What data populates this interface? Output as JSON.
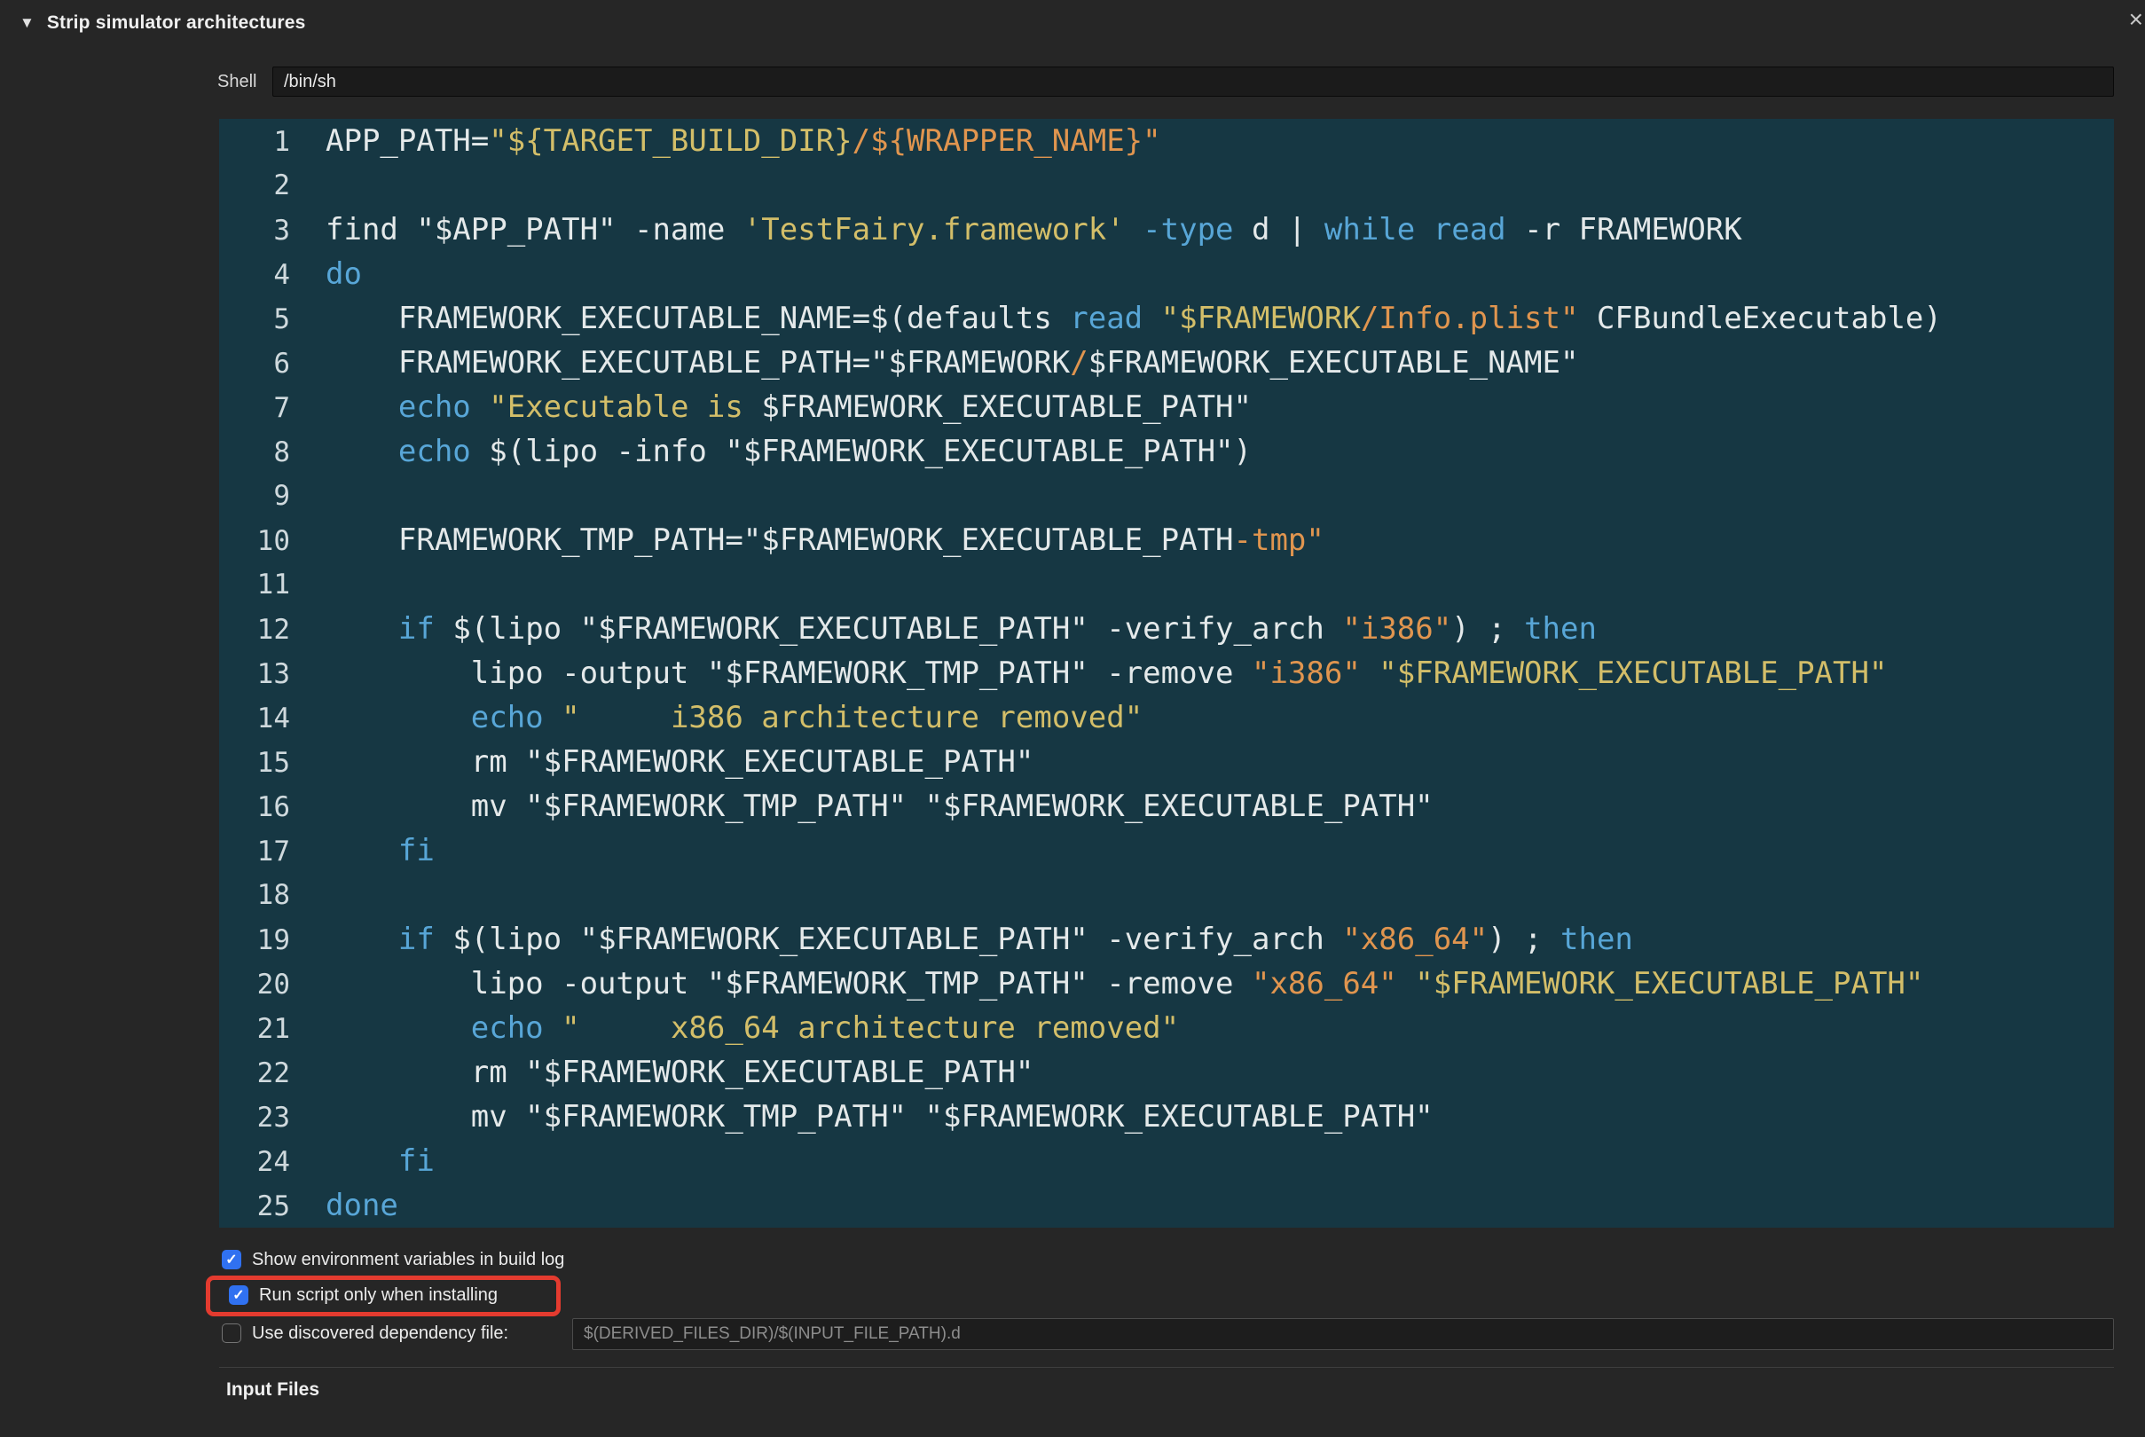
{
  "header": {
    "title": "Strip simulator architectures"
  },
  "icons": {
    "disclosure": "▼",
    "close": "×",
    "check": "✓"
  },
  "shell_row": {
    "label": "Shell",
    "value": "/bin/sh"
  },
  "colors": {
    "page_background": "#262626",
    "editor_background": "#163743",
    "code_plain": "#e4e9ea",
    "code_keyword": "#58a6d7",
    "code_string_yellow": "#d3be69",
    "code_string_orange": "#e0954f",
    "checkbox_accent": "#3071f0",
    "annotation_red": "#e43b2f"
  },
  "editor": {
    "lines": [
      {
        "num": "1",
        "tokens": [
          [
            "p",
            "APP_PATH="
          ],
          [
            "s",
            "\"${TARGET_BUILD_DIR}"
          ],
          [
            "o",
            "/${WRAPPER_NAME}\""
          ]
        ]
      },
      {
        "num": "2",
        "tokens": []
      },
      {
        "num": "3",
        "tokens": [
          [
            "p",
            "find \"$APP_PATH\" -name "
          ],
          [
            "s",
            "'TestFairy.framework'"
          ],
          [
            "p",
            " "
          ],
          [
            "k",
            "-type"
          ],
          [
            "p",
            " d | "
          ],
          [
            "k",
            "while"
          ],
          [
            "p",
            " "
          ],
          [
            "k",
            "read"
          ],
          [
            "p",
            " -r FRAMEWORK"
          ]
        ]
      },
      {
        "num": "4",
        "tokens": [
          [
            "k",
            "do"
          ]
        ]
      },
      {
        "num": "5",
        "tokens": [
          [
            "p",
            "    FRAMEWORK_EXECUTABLE_NAME=$(defaults "
          ],
          [
            "k",
            "read"
          ],
          [
            "p",
            " "
          ],
          [
            "s",
            "\"$FRAMEWORK"
          ],
          [
            "o",
            "/Info.plist\""
          ],
          [
            "p",
            " CFBundleExecutable)"
          ]
        ]
      },
      {
        "num": "6",
        "tokens": [
          [
            "p",
            "    FRAMEWORK_EXECUTABLE_PATH=\"$FRAMEWORK"
          ],
          [
            "o",
            "/"
          ],
          [
            "p",
            "$FRAMEWORK_EXECUTABLE_NAME\""
          ]
        ]
      },
      {
        "num": "7",
        "tokens": [
          [
            "p",
            "    "
          ],
          [
            "k",
            "echo"
          ],
          [
            "p",
            " "
          ],
          [
            "s",
            "\"Executable is "
          ],
          [
            "p",
            "$FRAMEWORK_EXECUTABLE_PATH\""
          ]
        ]
      },
      {
        "num": "8",
        "tokens": [
          [
            "p",
            "    "
          ],
          [
            "k",
            "echo"
          ],
          [
            "p",
            " $(lipo -info \"$FRAMEWORK_EXECUTABLE_PATH\")"
          ]
        ]
      },
      {
        "num": "9",
        "tokens": []
      },
      {
        "num": "10",
        "tokens": [
          [
            "p",
            "    FRAMEWORK_TMP_PATH=\"$FRAMEWORK_EXECUTABLE_PATH"
          ],
          [
            "o",
            "-tmp\""
          ]
        ]
      },
      {
        "num": "11",
        "tokens": []
      },
      {
        "num": "12",
        "tokens": [
          [
            "p",
            "    "
          ],
          [
            "k",
            "if"
          ],
          [
            "p",
            " $(lipo \"$FRAMEWORK_EXECUTABLE_PATH\" -verify_arch "
          ],
          [
            "o",
            "\"i386\""
          ],
          [
            "p",
            ") ; "
          ],
          [
            "k",
            "then"
          ]
        ]
      },
      {
        "num": "13",
        "tokens": [
          [
            "p",
            "        lipo -output \"$FRAMEWORK_TMP_PATH\" -remove "
          ],
          [
            "o",
            "\"i386\""
          ],
          [
            "p",
            " "
          ],
          [
            "s",
            "\"$FRAMEWORK_EXECUTABLE_PATH\""
          ]
        ]
      },
      {
        "num": "14",
        "tokens": [
          [
            "p",
            "        "
          ],
          [
            "k",
            "echo"
          ],
          [
            "p",
            " "
          ],
          [
            "s",
            "\"     i386 architecture removed\""
          ]
        ]
      },
      {
        "num": "15",
        "tokens": [
          [
            "p",
            "        rm \"$FRAMEWORK_EXECUTABLE_PATH\""
          ]
        ]
      },
      {
        "num": "16",
        "tokens": [
          [
            "p",
            "        mv \"$FRAMEWORK_TMP_PATH\" \"$FRAMEWORK_EXECUTABLE_PATH\""
          ]
        ]
      },
      {
        "num": "17",
        "tokens": [
          [
            "p",
            "    "
          ],
          [
            "k",
            "fi"
          ]
        ]
      },
      {
        "num": "18",
        "tokens": []
      },
      {
        "num": "19",
        "tokens": [
          [
            "p",
            "    "
          ],
          [
            "k",
            "if"
          ],
          [
            "p",
            " $(lipo \"$FRAMEWORK_EXECUTABLE_PATH\" -verify_arch "
          ],
          [
            "o",
            "\"x86_64\""
          ],
          [
            "p",
            ") ; "
          ],
          [
            "k",
            "then"
          ]
        ]
      },
      {
        "num": "20",
        "tokens": [
          [
            "p",
            "        lipo -output \"$FRAMEWORK_TMP_PATH\" -remove "
          ],
          [
            "o",
            "\"x86_64\""
          ],
          [
            "p",
            " "
          ],
          [
            "s",
            "\"$FRAMEWORK_EXECUTABLE_PATH\""
          ]
        ]
      },
      {
        "num": "21",
        "tokens": [
          [
            "p",
            "        "
          ],
          [
            "k",
            "echo"
          ],
          [
            "p",
            " "
          ],
          [
            "s",
            "\"     x86_64 architecture removed\""
          ]
        ]
      },
      {
        "num": "22",
        "tokens": [
          [
            "p",
            "        rm \"$FRAMEWORK_EXECUTABLE_PATH\""
          ]
        ]
      },
      {
        "num": "23",
        "tokens": [
          [
            "p",
            "        mv \"$FRAMEWORK_TMP_PATH\" \"$FRAMEWORK_EXECUTABLE_PATH\""
          ]
        ]
      },
      {
        "num": "24",
        "tokens": [
          [
            "p",
            "    "
          ],
          [
            "k",
            "fi"
          ]
        ]
      },
      {
        "num": "25",
        "tokens": [
          [
            "k",
            "done"
          ]
        ]
      }
    ]
  },
  "options": {
    "show_env": {
      "label": "Show environment variables in build log",
      "checked": true
    },
    "run_install": {
      "label": "Run script only when installing",
      "checked": true
    },
    "dependency": {
      "label": "Use discovered dependency file:",
      "checked": false,
      "placeholder": "$(DERIVED_FILES_DIR)/$(INPUT_FILE_PATH).d"
    }
  },
  "input_files": {
    "title": "Input Files"
  }
}
